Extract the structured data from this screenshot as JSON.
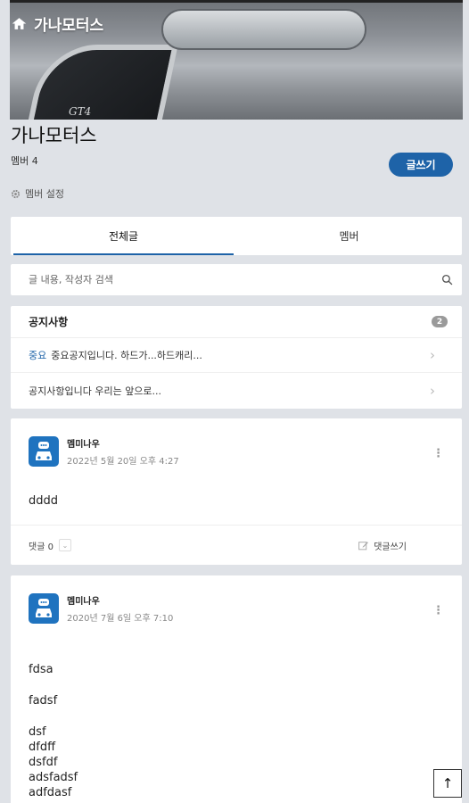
{
  "header": {
    "title": "가나모터스",
    "hero_badge": "GT4"
  },
  "club": {
    "name": "가나모터스",
    "member_count": "멤버 4",
    "write_button": "글쓰기",
    "settings_label": "멤버 설정"
  },
  "tabs": [
    {
      "label": "전체글",
      "active": true
    },
    {
      "label": "멤버",
      "active": false
    }
  ],
  "search": {
    "placeholder": "글 내용, 작성자 검색"
  },
  "notices": {
    "title": "공지사항",
    "count": "2",
    "items": [
      {
        "tag": "중요",
        "text": "중요공지입니다. 하드가...하드캐리..."
      },
      {
        "tag": "",
        "text": "공지사항입니다 우리는 앞으로..."
      }
    ]
  },
  "posts": [
    {
      "author": "멤미나우",
      "date": "2022년 5월 20일 오후 4:27",
      "body": [
        "dddd"
      ],
      "comments_label": "댓글 0",
      "write_comment_label": "댓글쓰기"
    },
    {
      "author": "멤미나우",
      "date": "2020년 7월 6일 오후 7:10",
      "body": [
        "fdsa",
        "fadsf",
        "dsf",
        "dfdff",
        "dsfdf",
        "adsfadsf",
        "adfdasf"
      ]
    }
  ],
  "colors": {
    "accent": "#1e63a8",
    "avatar": "#1f73bf",
    "background": "#dfe2e7"
  },
  "icons": {
    "home": "home-icon",
    "gear": "gear-icon",
    "search": "search-icon",
    "chevron": "chevron-right-icon",
    "kebab": "kebab-menu-icon",
    "edit": "edit-icon",
    "scroll_top": "arrow-up-icon"
  }
}
